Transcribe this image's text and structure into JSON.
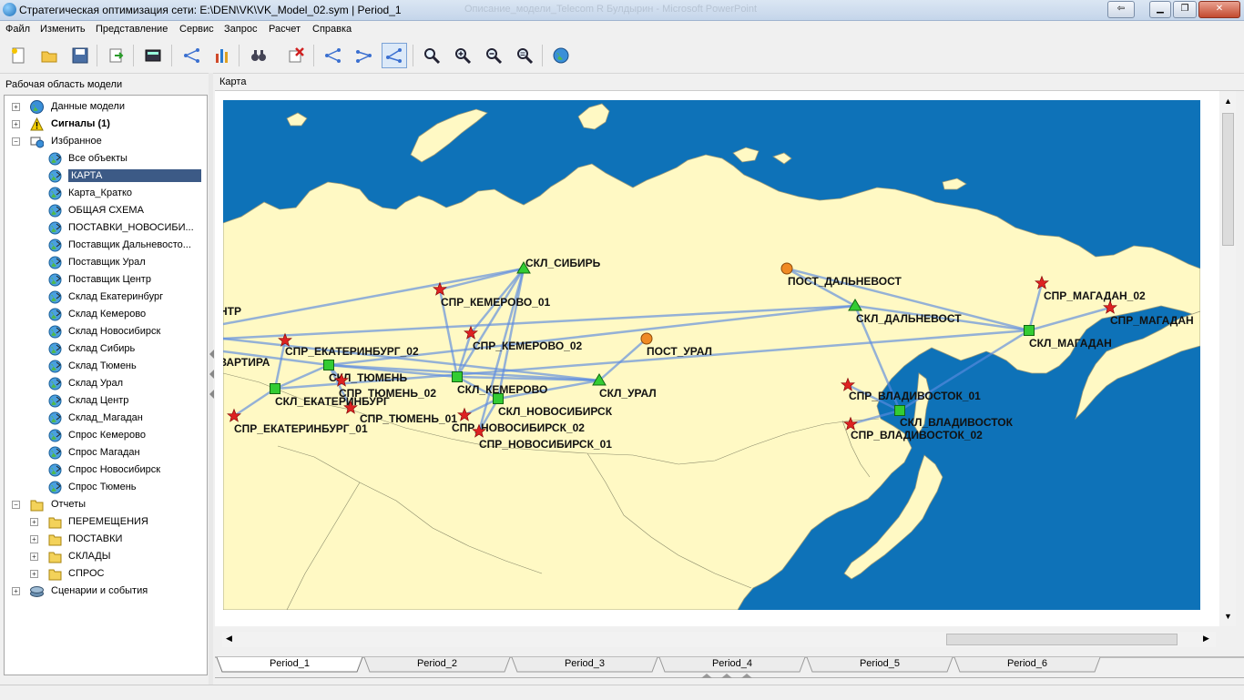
{
  "window": {
    "title": "Стратегическая оптимизация сети:   E:\\DEN\\VK\\VK_Model_02.sym | Period_1",
    "background_title": "Описание_модели_Telecom R Булдырин    -    Microsoft PowerPoint",
    "min_label": "▁",
    "max_label": "❐",
    "close_label": "✕",
    "restore_label": "⇦"
  },
  "menu": [
    "Файл",
    "Изменить",
    "Представление",
    "Сервис",
    "Запрос",
    "Расчет",
    "Справка"
  ],
  "toolbar": {
    "icons": [
      "new-file-icon",
      "open-folder-icon",
      "save-icon",
      "export-icon",
      "calculator-icon",
      "network-icon",
      "bar-chart-icon",
      "binoculars-icon",
      "delete-icon",
      "network-view-1-icon",
      "network-view-2-icon",
      "network-view-3-icon",
      "zoom-icon",
      "zoom-in-icon",
      "zoom-out-icon",
      "zoom-reset-icon",
      "globe-icon"
    ]
  },
  "left_panel": {
    "title": "Рабочая область модели",
    "tree": [
      {
        "label": "Данные модели",
        "level": 0,
        "expander": "+",
        "icon": "globe",
        "bold": false
      },
      {
        "label": "Сигналы  (1)",
        "level": 0,
        "expander": "+",
        "icon": "warning",
        "bold": true
      },
      {
        "label": "Избранное",
        "level": 0,
        "expander": "−",
        "icon": "favorites",
        "bold": false
      },
      {
        "label": "Все объекты",
        "level": 1,
        "icon": "map-view"
      },
      {
        "label": "КАРТА",
        "level": 1,
        "icon": "map-view",
        "selected": true
      },
      {
        "label": "Карта_Кратко",
        "level": 1,
        "icon": "map-view"
      },
      {
        "label": "ОБЩАЯ СХЕМА",
        "level": 1,
        "icon": "map-view"
      },
      {
        "label": "ПОСТАВКИ_НОВОСИБИ...",
        "level": 1,
        "icon": "map-view"
      },
      {
        "label": "Поставщик Дальневосто...",
        "level": 1,
        "icon": "map-view"
      },
      {
        "label": "Поставщик Урал",
        "level": 1,
        "icon": "map-view"
      },
      {
        "label": "Поставщик Центр",
        "level": 1,
        "icon": "map-view"
      },
      {
        "label": "Склад Екатеринбург",
        "level": 1,
        "icon": "map-view"
      },
      {
        "label": "Склад Кемерово",
        "level": 1,
        "icon": "map-view"
      },
      {
        "label": "Склад Новосибирск",
        "level": 1,
        "icon": "map-view"
      },
      {
        "label": "Склад Сибирь",
        "level": 1,
        "icon": "map-view"
      },
      {
        "label": "Склад Тюмень",
        "level": 1,
        "icon": "map-view"
      },
      {
        "label": "Склад Урал",
        "level": 1,
        "icon": "map-view"
      },
      {
        "label": "Склад Центр",
        "level": 1,
        "icon": "map-view"
      },
      {
        "label": "Склад_Магадан",
        "level": 1,
        "icon": "map-view"
      },
      {
        "label": "Спрос Кемерово",
        "level": 1,
        "icon": "map-view"
      },
      {
        "label": "Спрос Магадан",
        "level": 1,
        "icon": "map-view"
      },
      {
        "label": "Спрос Новосибирск",
        "level": 1,
        "icon": "map-view"
      },
      {
        "label": "Спрос Тюмень",
        "level": 1,
        "icon": "map-view"
      },
      {
        "label": "Отчеты",
        "level": 0,
        "expander": "−",
        "icon": "folder"
      },
      {
        "label": "ПЕРЕМЕЩЕНИЯ",
        "level": 1,
        "expander": "+",
        "icon": "folder"
      },
      {
        "label": "ПОСТАВКИ",
        "level": 1,
        "expander": "+",
        "icon": "folder"
      },
      {
        "label": "СКЛАДЫ",
        "level": 1,
        "expander": "+",
        "icon": "folder"
      },
      {
        "label": "СПРОС",
        "level": 1,
        "expander": "+",
        "icon": "folder"
      },
      {
        "label": "Сценарии и события",
        "level": 0,
        "expander": "+",
        "icon": "scenario"
      }
    ]
  },
  "map_panel": {
    "title": "Карта",
    "colors": {
      "sea": "#0e72b8",
      "land": "#fff9c4",
      "link": "#5a8be0",
      "warehouse": "#33cc33",
      "demand": "#dd2222",
      "supplier": "#f08a24"
    },
    "nodes": [
      {
        "name": "СКЛ_СИБИРЬ",
        "type": "source"
      },
      {
        "name": "СПР_КЕМЕРОВО_01",
        "type": "demand"
      },
      {
        "name": "СПР_КЕМЕРОВО_02",
        "type": "demand"
      },
      {
        "name": "ПОСТ_УРАЛ",
        "type": "supplier"
      },
      {
        "name": "ПОСТ_ДАЛЬНЕВОСТ",
        "type": "supplier"
      },
      {
        "name": "СКЛ_ДАЛЬНЕВОСТ",
        "type": "source"
      },
      {
        "name": "СПР_МАГАДАН_02",
        "type": "demand"
      },
      {
        "name": "СПР_МАГАДАН",
        "type": "demand"
      },
      {
        "name": "СКЛ_МАГАДАН",
        "type": "warehouse"
      },
      {
        "name": "ЕНТР",
        "type": "label"
      },
      {
        "name": "СПР_ЕКАТЕРИНБУРГ_02",
        "type": "demand"
      },
      {
        "name": "КВАРТИРА",
        "type": "label"
      },
      {
        "name": "СКЛ_ТЮМЕНЬ",
        "type": "warehouse"
      },
      {
        "name": "СКЛ_КЕМЕРОВО",
        "type": "warehouse"
      },
      {
        "name": "СКЛ_УРАЛ",
        "type": "source"
      },
      {
        "name": "СПР_ТЮМЕНЬ_02",
        "type": "demand"
      },
      {
        "name": "СКЛ_ЕКАТЕРИНБУРГ",
        "type": "warehouse"
      },
      {
        "name": "СКЛ_НОВОСИБИРСК",
        "type": "warehouse"
      },
      {
        "name": "СПР_ТЮМЕНЬ_01",
        "type": "demand"
      },
      {
        "name": "СПР_НОВОСИБИРСК_02",
        "type": "demand"
      },
      {
        "name": "СПР_ЕКАТЕРИНБУРГ_01",
        "type": "demand"
      },
      {
        "name": "СПР_НОВОСИБИРСК_01",
        "type": "demand"
      },
      {
        "name": "СПР_ВЛАДИВОСТОК_01",
        "type": "demand"
      },
      {
        "name": "СКЛ_ВЛАДИВОСТОК",
        "type": "warehouse"
      },
      {
        "name": "СПР_ВЛАДИВОСТОК_02",
        "type": "demand"
      }
    ]
  },
  "tabs": [
    "Period_1",
    "Period_2",
    "Period_3",
    "Period_4",
    "Period_5",
    "Period_6"
  ],
  "active_tab": "Period_1"
}
